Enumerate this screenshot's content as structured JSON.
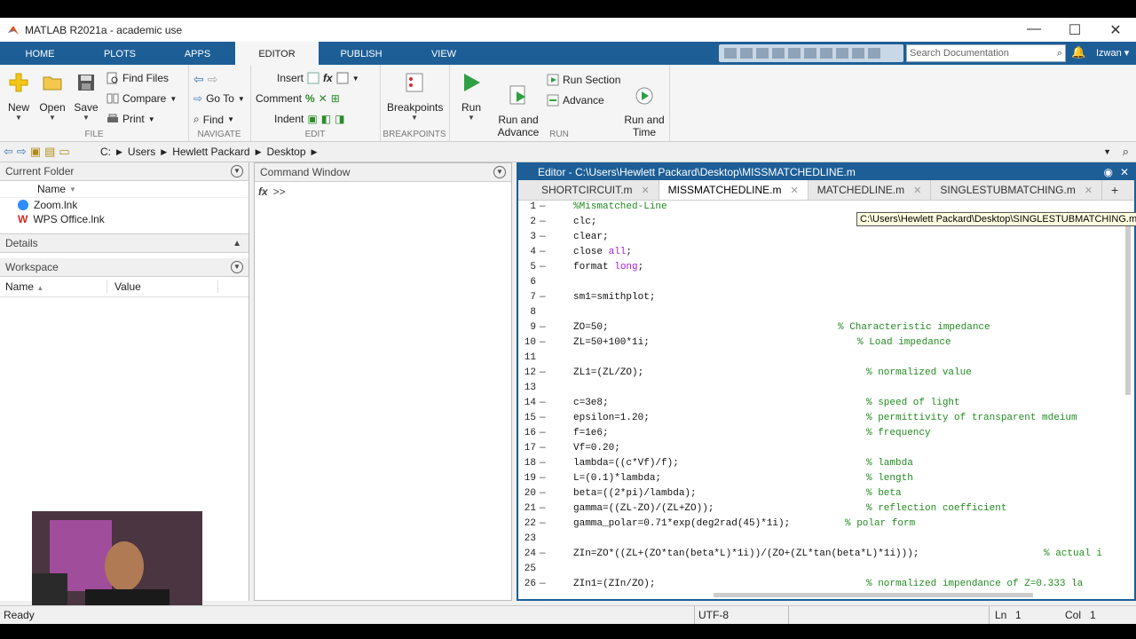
{
  "window": {
    "title": "MATLAB R2021a - academic use"
  },
  "toolstrip_tabs": [
    "HOME",
    "PLOTS",
    "APPS",
    "EDITOR",
    "PUBLISH",
    "VIEW"
  ],
  "search": {
    "placeholder": "Search Documentation"
  },
  "user": "Izwan ▾",
  "ribbon": {
    "file": {
      "new": "New",
      "open": "Open",
      "save": "Save",
      "find_files": "Find Files",
      "compare": "Compare",
      "print": "Print",
      "label": "FILE"
    },
    "navigate": {
      "go_to": "Go To",
      "find": "Find",
      "label": "NAVIGATE"
    },
    "edit": {
      "insert": "Insert",
      "comment": "Comment",
      "indent": "Indent",
      "label": "EDIT"
    },
    "breakpoints": {
      "breakpoints": "Breakpoints",
      "label": "BREAKPOINTS"
    },
    "run": {
      "run": "Run",
      "run_and_advance": "Run and\nAdvance",
      "run_section": "Run Section",
      "advance": "Advance",
      "run_and_time": "Run and\nTime",
      "label": "RUN"
    }
  },
  "breadcrumb": [
    "C:",
    "Users",
    "Hewlett Packard",
    "Desktop"
  ],
  "current_folder": {
    "title": "Current Folder",
    "column": "Name",
    "files": [
      "Zoom.lnk",
      "WPS Office.lnk"
    ]
  },
  "details": {
    "title": "Details"
  },
  "workspace": {
    "title": "Workspace",
    "columns": [
      "Name",
      "Value"
    ]
  },
  "command_window": {
    "title": "Command Window",
    "fx": "fx",
    "prompt": ">>"
  },
  "editor": {
    "title": "Editor - C:\\Users\\Hewlett Packard\\Desktop\\MISSMATCHEDLINE.m",
    "tabs": [
      "SHORTCIRCUIT.m",
      "MISSMATCHEDLINE.m",
      "MATCHEDLINE.m",
      "SINGLESTUBMATCHING.m"
    ],
    "active_tab": "MISSMATCHEDLINE.m",
    "tooltip": "C:\\Users\\Hewlett Packard\\Desktop\\SINGLESTUBMATCHING.m",
    "lines": [
      {
        "n": "1",
        "dash": "—",
        "code": "%Mismatched-Line",
        "cmt": ""
      },
      {
        "n": "2",
        "dash": "—",
        "code": "clc;",
        "cmt": ""
      },
      {
        "n": "3",
        "dash": "—",
        "code": "clear;",
        "cmt": ""
      },
      {
        "n": "4",
        "dash": "—",
        "code": "close all;",
        "cmt": ""
      },
      {
        "n": "5",
        "dash": "—",
        "code": "format long;",
        "cmt": ""
      },
      {
        "n": "6",
        "dash": "",
        "code": "",
        "cmt": ""
      },
      {
        "n": "7",
        "dash": "—",
        "code": "sm1=smithplot;",
        "cmt": ""
      },
      {
        "n": "8",
        "dash": "",
        "code": "",
        "cmt": ""
      },
      {
        "n": "9",
        "dash": "—",
        "code": "ZO=50;",
        "cmt": "% Characteristic impedance"
      },
      {
        "n": "10",
        "dash": "—",
        "code": "ZL=50+100*1i;",
        "cmt": "% Load impedance"
      },
      {
        "n": "11",
        "dash": "",
        "code": "",
        "cmt": ""
      },
      {
        "n": "12",
        "dash": "—",
        "code": "ZL1=(ZL/ZO);",
        "cmt": "% normalized value"
      },
      {
        "n": "13",
        "dash": "",
        "code": "",
        "cmt": ""
      },
      {
        "n": "14",
        "dash": "—",
        "code": "c=3e8;",
        "cmt": "% speed of light"
      },
      {
        "n": "15",
        "dash": "—",
        "code": "epsilon=1.20;",
        "cmt": "% permittivity of transparent mdeium"
      },
      {
        "n": "16",
        "dash": "—",
        "code": "f=1e6;",
        "cmt": "% frequency"
      },
      {
        "n": "17",
        "dash": "—",
        "code": "Vf=0.20;",
        "cmt": ""
      },
      {
        "n": "18",
        "dash": "—",
        "code": "lambda=((c*Vf)/f);",
        "cmt": "% lambda"
      },
      {
        "n": "19",
        "dash": "—",
        "code": "L=(0.1)*lambda;",
        "cmt": "% length"
      },
      {
        "n": "20",
        "dash": "—",
        "code": "beta=((2*pi)/lambda);",
        "cmt": "% beta"
      },
      {
        "n": "21",
        "dash": "—",
        "code": "gamma=((ZL-ZO)/(ZL+ZO));",
        "cmt": "% reflection coefficient"
      },
      {
        "n": "22",
        "dash": "—",
        "code": "gamma_polar=0.71*exp(deg2rad(45)*1i);",
        "cmt": "% polar form"
      },
      {
        "n": "23",
        "dash": "",
        "code": "",
        "cmt": ""
      },
      {
        "n": "24",
        "dash": "—",
        "code": "ZIn=ZO*((ZL+(ZO*tan(beta*L)*1i))/(ZO+(ZL*tan(beta*L)*1i)));",
        "cmt": "% actual i"
      },
      {
        "n": "25",
        "dash": "",
        "code": "",
        "cmt": ""
      },
      {
        "n": "26",
        "dash": "—",
        "code": "ZIn1=(ZIn/ZO);",
        "cmt": "% normalized impendance of Z=0.333 la"
      }
    ]
  },
  "status": {
    "ready": "Ready",
    "encoding": "UTF-8",
    "ln_label": "Ln",
    "ln": "1",
    "col_label": "Col",
    "col": "1"
  },
  "colors": {
    "accent": "#1d5e97",
    "comment": "#228b22",
    "keyword": "#a020f0"
  }
}
